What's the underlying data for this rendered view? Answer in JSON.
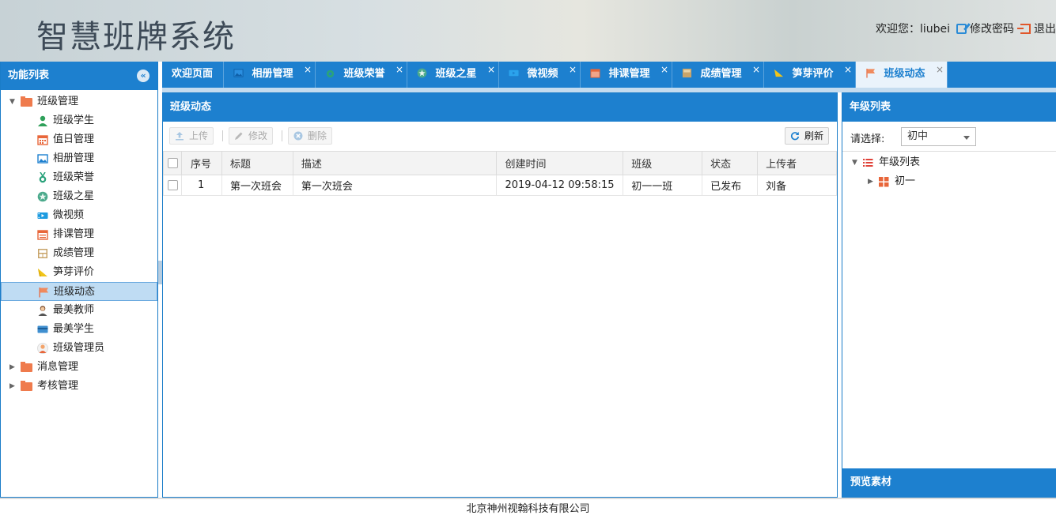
{
  "header": {
    "title": "智慧班牌系统",
    "welcome": "欢迎您：liubei",
    "change_password": "修改密码",
    "logout": "退出"
  },
  "sidebar": {
    "title": "功能列表",
    "groups": [
      {
        "label": "班级管理",
        "expanded": true,
        "items": [
          {
            "label": "班级学生",
            "icon": "student-icon"
          },
          {
            "label": "值日管理",
            "icon": "calendar-icon"
          },
          {
            "label": "相册管理",
            "icon": "album-icon"
          },
          {
            "label": "班级荣誉",
            "icon": "medal-icon"
          },
          {
            "label": "班级之星",
            "icon": "star-icon"
          },
          {
            "label": "微视频",
            "icon": "video-icon"
          },
          {
            "label": "排课管理",
            "icon": "schedule-icon"
          },
          {
            "label": "成绩管理",
            "icon": "score-icon"
          },
          {
            "label": "笋芽评价",
            "icon": "sprout-icon"
          },
          {
            "label": "班级动态",
            "icon": "flag-icon",
            "selected": true
          },
          {
            "label": "最美教师",
            "icon": "teacher-icon"
          },
          {
            "label": "最美学生",
            "icon": "card-icon"
          },
          {
            "label": "班级管理员",
            "icon": "admin-icon"
          }
        ]
      },
      {
        "label": "消息管理",
        "expanded": false
      },
      {
        "label": "考核管理",
        "expanded": false
      }
    ]
  },
  "tabs": [
    {
      "label": "欢迎页面",
      "closable": false
    },
    {
      "label": "相册管理",
      "closable": true
    },
    {
      "label": "班级荣誉",
      "closable": true
    },
    {
      "label": "班级之星",
      "closable": true
    },
    {
      "label": "微视频",
      "closable": true
    },
    {
      "label": "排课管理",
      "closable": true
    },
    {
      "label": "成绩管理",
      "closable": true
    },
    {
      "label": "笋芽评价",
      "closable": true
    },
    {
      "label": "班级动态",
      "closable": true,
      "active": true
    }
  ],
  "main": {
    "title": "班级动态",
    "toolbar": {
      "upload": "上传",
      "edit": "修改",
      "delete": "删除",
      "refresh": "刷新"
    },
    "columns": [
      "序号",
      "标题",
      "描述",
      "创建时间",
      "班级",
      "状态",
      "上传者"
    ],
    "rows": [
      {
        "index": "1",
        "title": "第一次班会",
        "desc": "第一次班会",
        "created": "2019-04-12 09:58:15",
        "class": "初一一班",
        "status": "已发布",
        "uploader": "刘备"
      }
    ]
  },
  "grade_panel": {
    "title": "年级列表",
    "select_label": "请选择:",
    "select_value": "初中",
    "tree_root": "年级列表",
    "tree_child": "初一",
    "preview_title": "预览素材"
  },
  "footer": {
    "text": "北京神州视翰科技有限公司"
  },
  "colors": {
    "primary": "#1d80cf",
    "selected_row": "#bfdcf3",
    "folder": "#ef7b4d",
    "published": "#2d8a2d"
  }
}
